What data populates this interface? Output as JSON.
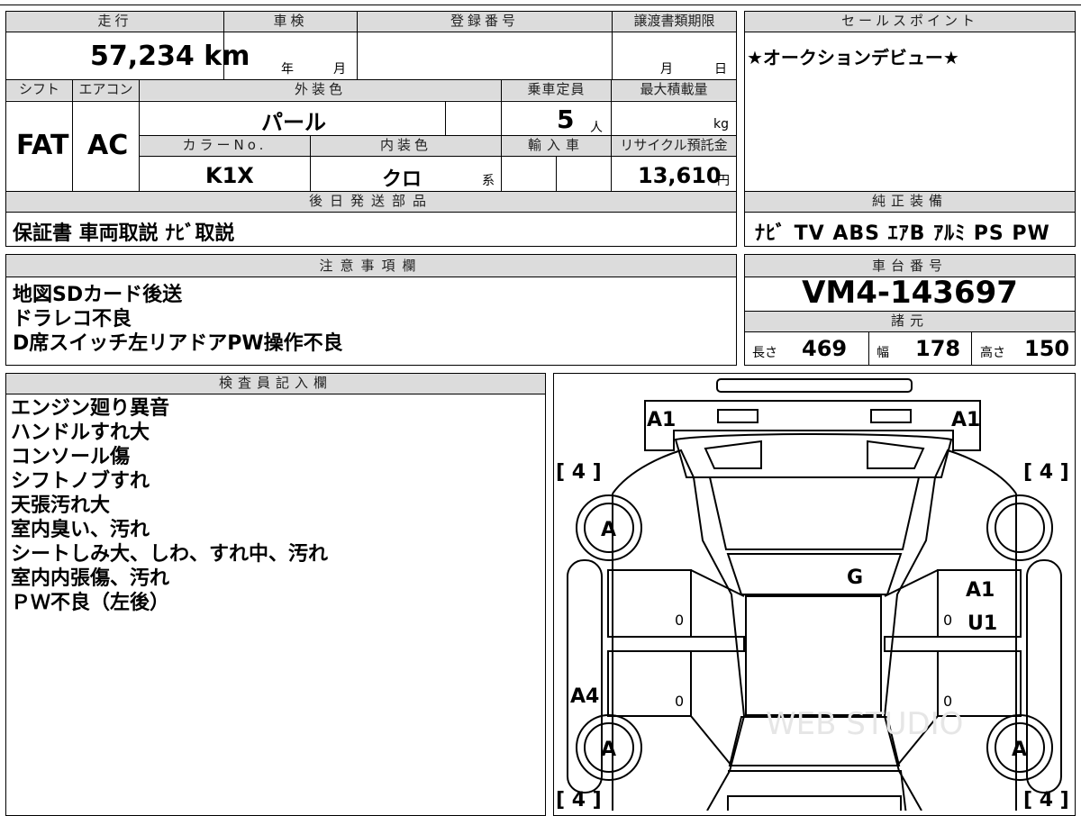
{
  "sheet": {
    "mileage_label": "走行",
    "mileage_value": "57,234 km",
    "shaken_label": "車検",
    "shaken_year_unit": "年",
    "shaken_month_unit": "月",
    "reg_number_label": "登録番号",
    "transfer_deadline_label": "譲渡書類期限",
    "transfer_month_unit": "月",
    "transfer_day_unit": "日",
    "shift_label": "シフト",
    "shift_value": "FAT",
    "aircon_label": "エアコン",
    "aircon_value": "AC",
    "ext_color_label": "外装色",
    "ext_color_value": "パール",
    "capacity_label": "乗車定員",
    "capacity_value": "5",
    "capacity_unit": "人",
    "max_load_label": "最大積載量",
    "max_load_unit": "kg",
    "color_no_label": "カラーNo.",
    "color_no_value": "K1X",
    "int_color_label": "内装色",
    "int_color_value": "クロ",
    "int_color_suffix": "系",
    "import_label": "輸入車",
    "recycle_label": "リサイクル預託金",
    "recycle_value": "13,610",
    "recycle_unit": "円",
    "later_parts_label": "後日発送部品",
    "later_parts_value": "保証書 車両取説 ﾅﾋﾞ取説",
    "sales_point_label": "セールスポイント",
    "sales_point_value": "★オークションデビュー★",
    "equipment_label": "純正装備",
    "equipment_value": "ﾅﾋﾞ TV ABS ｴｱB ｱﾙﾐ PS PW",
    "caution_label": "注意事項欄",
    "caution_lines": [
      "地図SDカード後送",
      "ドラレコ不良",
      "D席スイッチ左リアドアPW操作不良"
    ],
    "chassis_label": "車台番号",
    "chassis_value": "VM4-143697",
    "specs_label": "諸元",
    "length_label": "長さ",
    "length_value": "469",
    "width_label": "幅",
    "width_value": "178",
    "height_label": "高さ",
    "height_value": "150",
    "inspector_label": "検査員記入欄",
    "inspector_lines": [
      "エンジン廻り異音",
      "ハンドルすれ大",
      "コンソール傷",
      "シフトノブすれ",
      "天張汚れ大",
      "室内臭い、汚れ",
      "シートしみ大、しわ、すれ中、汚れ",
      "室内内張傷、汚れ",
      "ＰＷ不良（左後）"
    ]
  },
  "diagram": {
    "tire_front_left": "[ 4 ]",
    "tire_front_right": "[ 4 ]",
    "tire_rear_left": "[ 4 ]",
    "tire_rear_right": "[ 4 ]",
    "mark_front_bumper_left": "A1",
    "mark_front_bumper_right": "A1",
    "mark_front_wheel_left": "A",
    "mark_rear_wheel_left": "A",
    "mark_rear_wheel_right": "A",
    "mark_windshield": "G",
    "mark_right_front_door_1": "A1",
    "mark_right_front_door_2": "U1",
    "mark_left_rear_door": "A4",
    "door_zero_1": "0",
    "door_zero_2": "0",
    "door_zero_3": "0",
    "door_zero_4": "0",
    "watermark": "WEB STUDIO"
  }
}
